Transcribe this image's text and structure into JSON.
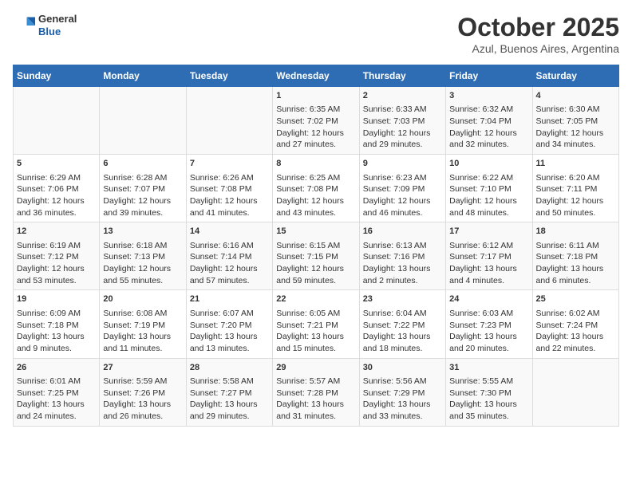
{
  "header": {
    "logo_general": "General",
    "logo_blue": "Blue",
    "title": "October 2025",
    "subtitle": "Azul, Buenos Aires, Argentina"
  },
  "days_of_week": [
    "Sunday",
    "Monday",
    "Tuesday",
    "Wednesday",
    "Thursday",
    "Friday",
    "Saturday"
  ],
  "weeks": [
    [
      {
        "day": "",
        "content": ""
      },
      {
        "day": "",
        "content": ""
      },
      {
        "day": "",
        "content": ""
      },
      {
        "day": "1",
        "content": "Sunrise: 6:35 AM\nSunset: 7:02 PM\nDaylight: 12 hours\nand 27 minutes."
      },
      {
        "day": "2",
        "content": "Sunrise: 6:33 AM\nSunset: 7:03 PM\nDaylight: 12 hours\nand 29 minutes."
      },
      {
        "day": "3",
        "content": "Sunrise: 6:32 AM\nSunset: 7:04 PM\nDaylight: 12 hours\nand 32 minutes."
      },
      {
        "day": "4",
        "content": "Sunrise: 6:30 AM\nSunset: 7:05 PM\nDaylight: 12 hours\nand 34 minutes."
      }
    ],
    [
      {
        "day": "5",
        "content": "Sunrise: 6:29 AM\nSunset: 7:06 PM\nDaylight: 12 hours\nand 36 minutes."
      },
      {
        "day": "6",
        "content": "Sunrise: 6:28 AM\nSunset: 7:07 PM\nDaylight: 12 hours\nand 39 minutes."
      },
      {
        "day": "7",
        "content": "Sunrise: 6:26 AM\nSunset: 7:08 PM\nDaylight: 12 hours\nand 41 minutes."
      },
      {
        "day": "8",
        "content": "Sunrise: 6:25 AM\nSunset: 7:08 PM\nDaylight: 12 hours\nand 43 minutes."
      },
      {
        "day": "9",
        "content": "Sunrise: 6:23 AM\nSunset: 7:09 PM\nDaylight: 12 hours\nand 46 minutes."
      },
      {
        "day": "10",
        "content": "Sunrise: 6:22 AM\nSunset: 7:10 PM\nDaylight: 12 hours\nand 48 minutes."
      },
      {
        "day": "11",
        "content": "Sunrise: 6:20 AM\nSunset: 7:11 PM\nDaylight: 12 hours\nand 50 minutes."
      }
    ],
    [
      {
        "day": "12",
        "content": "Sunrise: 6:19 AM\nSunset: 7:12 PM\nDaylight: 12 hours\nand 53 minutes."
      },
      {
        "day": "13",
        "content": "Sunrise: 6:18 AM\nSunset: 7:13 PM\nDaylight: 12 hours\nand 55 minutes."
      },
      {
        "day": "14",
        "content": "Sunrise: 6:16 AM\nSunset: 7:14 PM\nDaylight: 12 hours\nand 57 minutes."
      },
      {
        "day": "15",
        "content": "Sunrise: 6:15 AM\nSunset: 7:15 PM\nDaylight: 12 hours\nand 59 minutes."
      },
      {
        "day": "16",
        "content": "Sunrise: 6:13 AM\nSunset: 7:16 PM\nDaylight: 13 hours\nand 2 minutes."
      },
      {
        "day": "17",
        "content": "Sunrise: 6:12 AM\nSunset: 7:17 PM\nDaylight: 13 hours\nand 4 minutes."
      },
      {
        "day": "18",
        "content": "Sunrise: 6:11 AM\nSunset: 7:18 PM\nDaylight: 13 hours\nand 6 minutes."
      }
    ],
    [
      {
        "day": "19",
        "content": "Sunrise: 6:09 AM\nSunset: 7:18 PM\nDaylight: 13 hours\nand 9 minutes."
      },
      {
        "day": "20",
        "content": "Sunrise: 6:08 AM\nSunset: 7:19 PM\nDaylight: 13 hours\nand 11 minutes."
      },
      {
        "day": "21",
        "content": "Sunrise: 6:07 AM\nSunset: 7:20 PM\nDaylight: 13 hours\nand 13 minutes."
      },
      {
        "day": "22",
        "content": "Sunrise: 6:05 AM\nSunset: 7:21 PM\nDaylight: 13 hours\nand 15 minutes."
      },
      {
        "day": "23",
        "content": "Sunrise: 6:04 AM\nSunset: 7:22 PM\nDaylight: 13 hours\nand 18 minutes."
      },
      {
        "day": "24",
        "content": "Sunrise: 6:03 AM\nSunset: 7:23 PM\nDaylight: 13 hours\nand 20 minutes."
      },
      {
        "day": "25",
        "content": "Sunrise: 6:02 AM\nSunset: 7:24 PM\nDaylight: 13 hours\nand 22 minutes."
      }
    ],
    [
      {
        "day": "26",
        "content": "Sunrise: 6:01 AM\nSunset: 7:25 PM\nDaylight: 13 hours\nand 24 minutes."
      },
      {
        "day": "27",
        "content": "Sunrise: 5:59 AM\nSunset: 7:26 PM\nDaylight: 13 hours\nand 26 minutes."
      },
      {
        "day": "28",
        "content": "Sunrise: 5:58 AM\nSunset: 7:27 PM\nDaylight: 13 hours\nand 29 minutes."
      },
      {
        "day": "29",
        "content": "Sunrise: 5:57 AM\nSunset: 7:28 PM\nDaylight: 13 hours\nand 31 minutes."
      },
      {
        "day": "30",
        "content": "Sunrise: 5:56 AM\nSunset: 7:29 PM\nDaylight: 13 hours\nand 33 minutes."
      },
      {
        "day": "31",
        "content": "Sunrise: 5:55 AM\nSunset: 7:30 PM\nDaylight: 13 hours\nand 35 minutes."
      },
      {
        "day": "",
        "content": ""
      }
    ]
  ]
}
